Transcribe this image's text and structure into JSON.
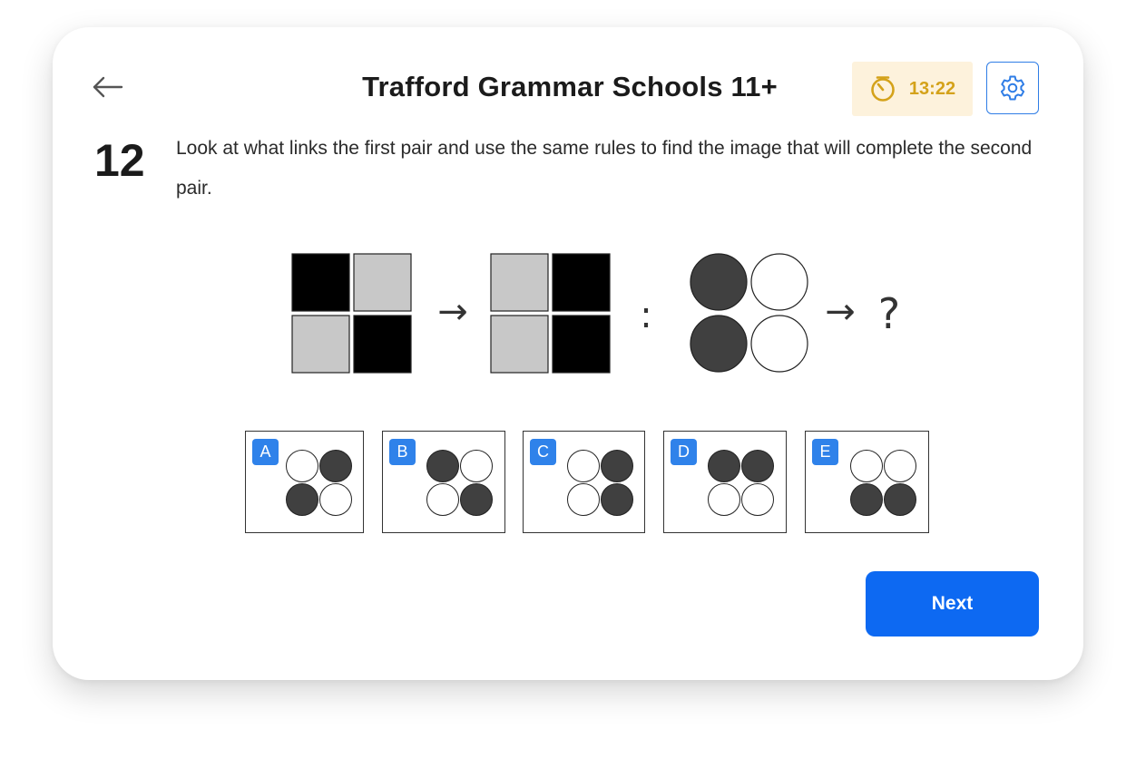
{
  "header": {
    "title": "Trafford Grammar Schools 11+",
    "back_icon": "arrow-left-icon",
    "timer": {
      "value": "13:22",
      "icon": "stopwatch-icon",
      "color": "#d4a21a",
      "background": "#fdf2dc"
    },
    "settings_icon": "gear-icon"
  },
  "question": {
    "number": "12",
    "text": "Look at what links the first pair and use the same rules to find the image that will complete the second pair."
  },
  "puzzle": {
    "pair1_before": [
      "black",
      "grey",
      "grey",
      "black"
    ],
    "pair1_after": [
      "grey",
      "black",
      "grey",
      "black"
    ],
    "pair2_before": [
      "dark",
      "white",
      "dark",
      "white"
    ],
    "arrow": "→",
    "separator": ":",
    "unknown": "?"
  },
  "options": [
    {
      "letter": "A",
      "cells": [
        "white",
        "dark",
        "dark",
        "white"
      ]
    },
    {
      "letter": "B",
      "cells": [
        "dark",
        "white",
        "white",
        "dark"
      ]
    },
    {
      "letter": "C",
      "cells": [
        "white",
        "dark",
        "white",
        "dark"
      ]
    },
    {
      "letter": "D",
      "cells": [
        "dark",
        "dark",
        "white",
        "white"
      ]
    },
    {
      "letter": "E",
      "cells": [
        "white",
        "white",
        "dark",
        "dark"
      ]
    }
  ],
  "next_label": "Next",
  "colors": {
    "black": "#000000",
    "grey": "#c8c8c8",
    "dark": "#404040",
    "white": "#ffffff",
    "accent": "#0d69f2",
    "option_badge": "#2f82ea"
  }
}
